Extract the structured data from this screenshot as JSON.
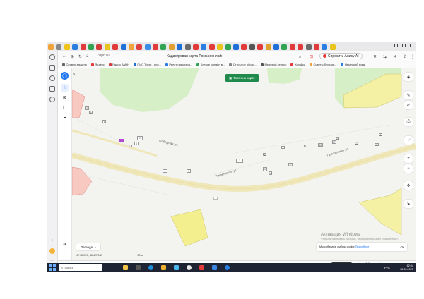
{
  "browser": {
    "url": "nspd.ru",
    "page_title": "Кадастровая карта России онлайн",
    "alice_button": "Спросить Алису AI",
    "tab_colors": [
      "#f0a33a",
      "#888888",
      "#f0c419",
      "#2a7de1",
      "#e03a3a",
      "#31a354",
      "#d63b3b",
      "#e8c41c",
      "#e03a3a",
      "#1f6fd8",
      "#f0a33a",
      "#e04040",
      "#3a8ee6",
      "#e03a3a",
      "#31a354",
      "#e0a030",
      "#1f6fd8",
      "#6a6a6a",
      "#e03a3a",
      "#2a7de1",
      "#e03a3a",
      "#e8c41c",
      "#31a354",
      "#1f6fd8",
      "#e03a3a",
      "#555555",
      "#e03a3a",
      "#e0a030",
      "#1f6fd8",
      "#31a354",
      "#e03a3a",
      "#e03a3a",
      "#6a6a6a",
      "#e03a3a",
      "#2a7de1",
      "#e8c41c"
    ]
  },
  "bookmarks": [
    {
      "label": "Сервер защиты",
      "color": "#666666"
    },
    {
      "label": "Яндекс",
      "color": "#e03a3a"
    },
    {
      "label": "Радио ВАНН",
      "color": "#d63b3b"
    },
    {
      "label": "ПИС Торги - про...",
      "color": "#1f6fd8"
    },
    {
      "label": "Реестр деклара...",
      "color": "#2a7de1"
    },
    {
      "label": "Клевое онлайн в...",
      "color": "#31a354"
    },
    {
      "label": "Открытое образ...",
      "color": "#888888"
    },
    {
      "label": "Межевой сервис",
      "color": "#555555"
    },
    {
      "label": "Хозяйка",
      "color": "#e03a3a"
    },
    {
      "label": "Советы бесплат...",
      "color": "#f0a33a"
    },
    {
      "label": "Немецкий язык",
      "color": "#2a7de1"
    }
  ],
  "map": {
    "trade_button": "Торги на карте",
    "street_1": "Победная ул.",
    "street_2": "Пионерская ул.",
    "street_3": "Приозерная ул.",
    "legend": "Легенда",
    "coords": "47.960178, 46.427842",
    "scale": "50 м",
    "cookie_text": "Мы собираем файлы cookie",
    "cookie_link": "Подробнее",
    "cookie_ok": "Ок",
    "activation_title": "Активация Windows",
    "activation_sub": "Чтобы активировать Windows, перейдите в раздел «Параметры».",
    "building_labels": [
      "3",
      "9",
      "1",
      "2",
      "4",
      "11",
      "4",
      "7",
      "3",
      "5",
      "15",
      "31",
      "33",
      "7",
      "9",
      "28",
      "27",
      "13",
      "22",
      "21",
      "8"
    ]
  },
  "bottom_strip": {
    "pill": "Нашли ошибку",
    "text": "Карты © Яндекс · Условия использования"
  },
  "taskbar": {
    "search": "Поиск",
    "lang": "РУС",
    "time": "12:04",
    "date": "18.05.2025"
  }
}
